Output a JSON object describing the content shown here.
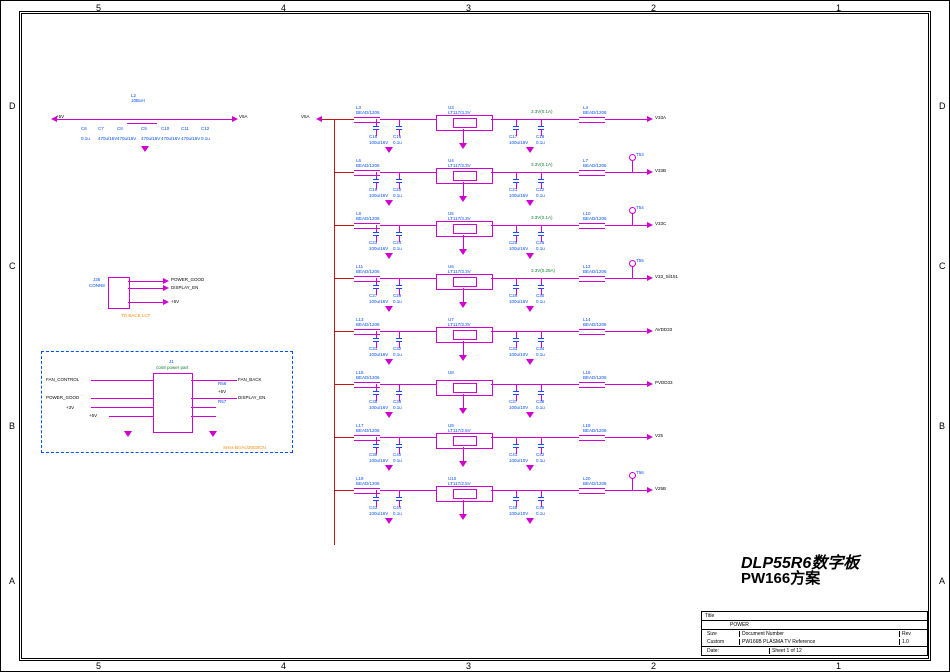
{
  "ruler_top": {
    "5": "5",
    "4": "4",
    "3": "3",
    "2": "2",
    "1": "1"
  },
  "ruler_side": {
    "D": "D",
    "C": "C",
    "B": "B",
    "A": "A"
  },
  "top_left": {
    "in": "+5V",
    "out": "V5A",
    "L2": "L2",
    "L2v": "10BuH",
    "C6": "C6",
    "C6v": "0.1u",
    "C7": "C7",
    "C7v": "470u/16V",
    "C8": "C8",
    "C8v": "470u/16V",
    "C9": "C9",
    "C9v": "470u/16V",
    "C10": "C10",
    "C10v": "470u/16V",
    "C11": "C11",
    "C11v": "470u/16V",
    "C12": "C12",
    "C12v": "0.1u"
  },
  "conn_j35": {
    "ref": "J35",
    "name": "CONN8",
    "pg": "POWER_GOOD",
    "de": "DISPLAY_EN",
    "p5": "+5V",
    "note": "TO BACK LCT"
  },
  "conn_j1": {
    "ref": "J1",
    "name": "con8 power part",
    "fc": "FAN_CONTROL",
    "fb": "FAN_BACK",
    "pg": "POWER_GOOD",
    "de": "DISPLAY_EN",
    "p5": "+5V",
    "p3": "+3V",
    "r56": "R56",
    "r57": "R57",
    "note": "SHxx Bc/Ac/2003/CN"
  },
  "regs": [
    {
      "Lin": "L3",
      "Linv": "BEAD/1206",
      "U": "U3",
      "Uv": "LT117/3.3V",
      "note": "3.3V(0.1A)",
      "Lout": "L4",
      "Loutv": "BEAD/1206",
      "out": "V33A",
      "Ci1": "C15",
      "Ci1v": "100u/16V",
      "Ci2": "C16",
      "Ci2v": "0.1u",
      "Co1": "C17",
      "Co1v": "100u/16V",
      "Co2": "C18",
      "Co2v": "0.1u",
      "tp": ""
    },
    {
      "Lin": "L6",
      "Linv": "BEAD/1206",
      "U": "U4",
      "Uv": "LT117/3.3V",
      "note": "3.3V(0.1A)",
      "Lout": "L7",
      "Loutv": "BEAD/1206",
      "out": "V33B",
      "Ci1": "C19",
      "Ci1v": "100u/16V",
      "Ci2": "C20",
      "Ci2v": "0.1u",
      "Co1": "C21",
      "Co1v": "100u/16V",
      "Co2": "C22",
      "Co2v": "0.1u",
      "tp": "T53"
    },
    {
      "Lin": "L8",
      "Linv": "BEAD/1206",
      "U": "U5",
      "Uv": "LT117/3.3V",
      "note": "3.3V(0.1A)",
      "Lout": "L10",
      "Loutv": "BEAD/1206",
      "out": "V33C",
      "Ci1": "C23",
      "Ci1v": "100u/16V",
      "Ci2": "C24",
      "Ci2v": "0.1u",
      "Co1": "C25",
      "Co1v": "100u/16V",
      "Co2": "C26",
      "Co2v": "0.1u",
      "tp": "T54"
    },
    {
      "Lin": "L11",
      "Linv": "BEAD/1206",
      "U": "U6",
      "Uv": "LT117/3.3V",
      "note": "3.3V(0.25A)",
      "Lout": "L12",
      "Loutv": "BEAD/1206",
      "out": "V33_Sil151",
      "Ci1": "C27",
      "Ci1v": "100u/16V",
      "Ci2": "C28",
      "Ci2v": "0.1u",
      "Co1": "C29",
      "Co1v": "100u/16V",
      "Co2": "C30",
      "Co2v": "0.1u",
      "tp": "T55"
    },
    {
      "Lin": "L13",
      "Linv": "BEAD/1206",
      "U": "U7",
      "Uv": "LT117/3.3V",
      "note": "",
      "Lout": "L14",
      "Loutv": "BEAD/1206",
      "out": "AVDD33",
      "Ci1": "C31",
      "Ci1v": "100u/16V",
      "Ci2": "C32",
      "Ci2v": "0.1u",
      "Co1": "C33",
      "Co1v": "100u/10V",
      "Co2": "C34",
      "Co2v": "0.1u",
      "tp": ""
    },
    {
      "Lin": "L15",
      "Linv": "BEAD/1206",
      "U": "U8",
      "Uv": "",
      "note": "",
      "Lout": "L16",
      "Loutv": "BEAD/1206",
      "out": "PVDD33",
      "Ci1": "C35",
      "Ci1v": "100u/16V",
      "Ci2": "C36",
      "Ci2v": "0.1u",
      "Co1": "C37",
      "Co1v": "100u/10V",
      "Co2": "C38",
      "Co2v": "0.1u",
      "tp": ""
    },
    {
      "Lin": "L17",
      "Linv": "BEAD/1206",
      "U": "U9",
      "Uv": "LT117/2.5V",
      "note": "",
      "Lout": "L18",
      "Loutv": "BEAD/1206",
      "out": "V25",
      "Ci1": "C39",
      "Ci1v": "100u/16V",
      "Ci2": "C40",
      "Ci2v": "0.1u",
      "Co1": "C41",
      "Co1v": "100u/10V",
      "Co2": "C42",
      "Co2v": "0.1u",
      "tp": ""
    },
    {
      "Lin": "L19",
      "Linv": "BEAD/1206",
      "U": "U10",
      "Uv": "LT117/2.5V",
      "note": "",
      "Lout": "L20",
      "Loutv": "BEAD/1206",
      "out": "V25B",
      "Ci1": "C43",
      "Ci1v": "100u/16V",
      "Ci2": "C44",
      "Ci2v": "0.1u",
      "Co1": "C45",
      "Co1v": "100u/10V",
      "Co2": "C46",
      "Co2v": "0.1u",
      "tp": "T56"
    }
  ],
  "v5a_label": "V5A",
  "title1": "DLP55R6数字板",
  "title2": "PW166方案",
  "tblock": {
    "title": "Title",
    "titlev": "POWER",
    "size": "Size",
    "sizev": "Custom",
    "docnum": "Document Number",
    "docv": "PW166B PLASMA TV Reference",
    "rev": "Rev",
    "revv": "1.0",
    "date": "Date:",
    "datev": "",
    "sheet": "Sheet",
    "sheetv": "1",
    "of": "of",
    "total": "12"
  }
}
